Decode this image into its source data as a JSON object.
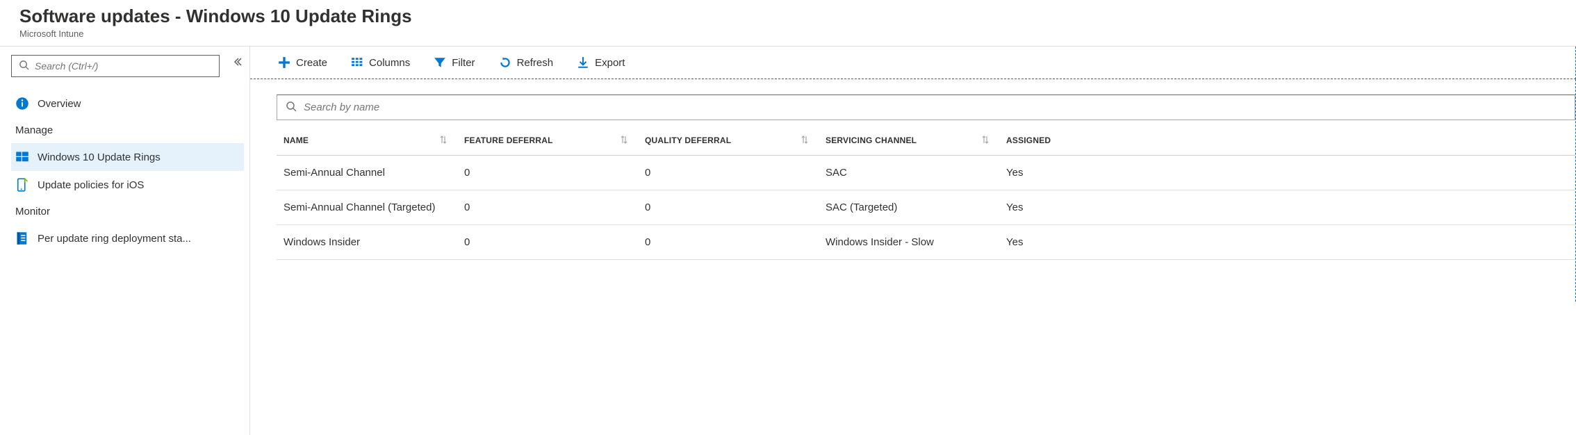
{
  "header": {
    "title": "Software updates - Windows 10 Update Rings",
    "subtitle": "Microsoft Intune"
  },
  "sidebar": {
    "search_placeholder": "Search (Ctrl+/)",
    "overview_label": "Overview",
    "section_manage": "Manage",
    "item_update_rings": "Windows 10 Update Rings",
    "item_ios_policies": "Update policies for iOS",
    "section_monitor": "Monitor",
    "item_deployment_status": "Per update ring deployment sta..."
  },
  "toolbar": {
    "create": "Create",
    "columns": "Columns",
    "filter": "Filter",
    "refresh": "Refresh",
    "export": "Export"
  },
  "main": {
    "filter_placeholder": "Search by name",
    "columns": {
      "name": "NAME",
      "feature_deferral": "FEATURE DEFERRAL",
      "quality_deferral": "QUALITY DEFERRAL",
      "servicing_channel": "SERVICING CHANNEL",
      "assigned": "ASSIGNED"
    },
    "rows": [
      {
        "name": "Semi-Annual Channel",
        "feature_deferral": "0",
        "quality_deferral": "0",
        "servicing_channel": "SAC",
        "assigned": "Yes"
      },
      {
        "name": "Semi-Annual Channel (Targeted)",
        "feature_deferral": "0",
        "quality_deferral": "0",
        "servicing_channel": "SAC (Targeted)",
        "assigned": "Yes"
      },
      {
        "name": "Windows Insider",
        "feature_deferral": "0",
        "quality_deferral": "0",
        "servicing_channel": "Windows Insider - Slow",
        "assigned": "Yes"
      }
    ]
  }
}
